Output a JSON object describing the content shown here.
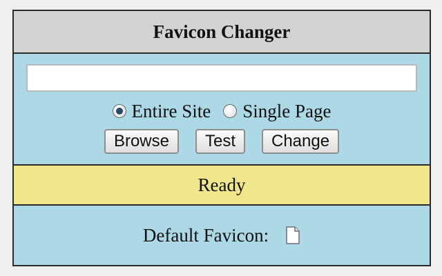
{
  "header": {
    "title": "Favicon Changer"
  },
  "controls": {
    "url_input": {
      "value": "",
      "placeholder": ""
    },
    "scope_options": [
      {
        "label": "Entire Site",
        "checked": true
      },
      {
        "label": "Single Page",
        "checked": false
      }
    ],
    "buttons": {
      "browse_label": "Browse",
      "test_label": "Test",
      "change_label": "Change"
    }
  },
  "status": {
    "text": "Ready"
  },
  "default_favicon": {
    "label": "Default Favicon:",
    "icon": "blank-document-icon"
  },
  "colors": {
    "panel_background": "#add8e6",
    "header_background": "#d3d3d3",
    "status_background": "#f0e68c"
  }
}
